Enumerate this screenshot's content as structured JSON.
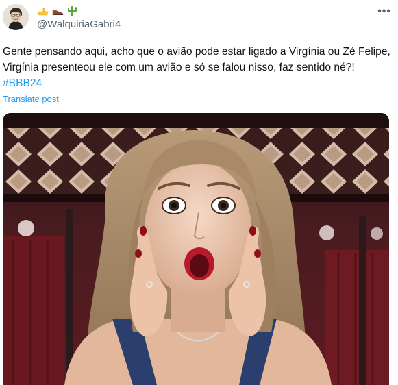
{
  "tweet": {
    "author": {
      "emojis": [
        "pointing-finger-icon",
        "leather-shoe-icon",
        "cactus-icon"
      ],
      "handle": "@WalquiriaGabri4"
    },
    "text_main": "Gente pensando aqui, acho que o avião pode estar ligado a Virgínia ou Zé Felipe, Virgínia presenteou ele com um avião e só se falou nisso, faz sentido né?! ",
    "hashtag": "#BBB24",
    "translate_label": "Translate post",
    "more_label": "•••"
  },
  "colors": {
    "link": "#1d9bf0",
    "secondary_text": "#536471",
    "primary_text": "#0f1419"
  }
}
